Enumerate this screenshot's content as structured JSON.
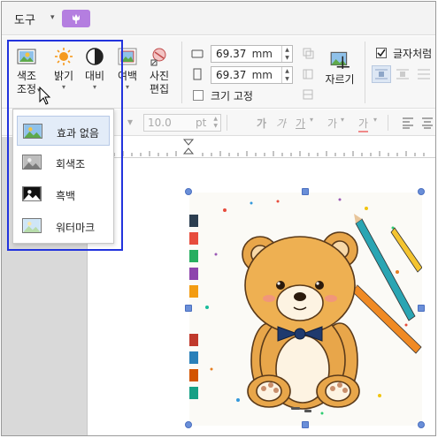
{
  "topbar": {
    "tools_tab": "도구",
    "caret": "▾"
  },
  "ribbon": {
    "color_adjust": {
      "line1": "색조",
      "line2": "조정",
      "caret": "▾"
    },
    "brightness": {
      "label": "밝기",
      "caret": "▾"
    },
    "contrast": {
      "label": "대비",
      "caret": "▾"
    },
    "margin": {
      "label": "여백",
      "caret": "▾"
    },
    "photo_edit": {
      "line1": "사진",
      "line2": "편집"
    },
    "width_value": "69.37",
    "height_value": "69.37",
    "unit": "mm",
    "fix_size_label": "크기 고정",
    "crop_label": "자르기",
    "as_char_label": "글자처럼"
  },
  "row2": {
    "font_size": "10.0",
    "font_unit": "pt"
  },
  "dropdown": {
    "items": [
      {
        "label": "효과 없음"
      },
      {
        "label": "회색조"
      },
      {
        "label": "흑백"
      },
      {
        "label": "워터마크"
      }
    ]
  },
  "colors": {
    "highlight": "#2233dd",
    "accent_purple": "#b47ee0",
    "handle": "#6a8fd8",
    "selected_item_bg": "#e3ecf8"
  }
}
